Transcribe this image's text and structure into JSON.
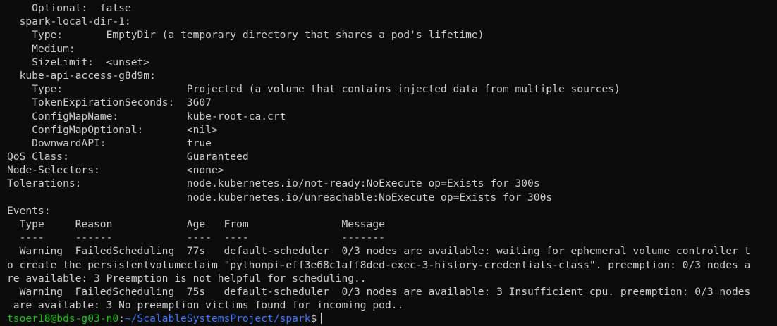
{
  "terminal": {
    "lines": [
      "    Optional:  false",
      "  spark-local-dir-1:",
      "    Type:       EmptyDir (a temporary directory that shares a pod's lifetime)",
      "    Medium:",
      "    SizeLimit:  <unset>",
      "  kube-api-access-g8d9m:",
      "    Type:                    Projected (a volume that contains injected data from multiple sources)",
      "    TokenExpirationSeconds:  3607",
      "    ConfigMapName:           kube-root-ca.crt",
      "    ConfigMapOptional:       <nil>",
      "    DownwardAPI:             true",
      "QoS Class:                   Guaranteed",
      "Node-Selectors:              <none>",
      "Tolerations:                 node.kubernetes.io/not-ready:NoExecute op=Exists for 300s",
      "                             node.kubernetes.io/unreachable:NoExecute op=Exists for 300s",
      "Events:",
      "  Type     Reason            Age   From               Message",
      "  ----     ------            ----  ----               -------",
      "  Warning  FailedScheduling  77s   default-scheduler  0/3 nodes are available: waiting for ephemeral volume controller t",
      "o create the persistentvolumeclaim \"pythonpi-eff3e68c1aff8ded-exec-3-history-credentials-class\". preemption: 0/3 nodes a",
      "re available: 3 Preemption is not helpful for scheduling..",
      "  Warning  FailedScheduling  75s   default-scheduler  0/3 nodes are available: 3 Insufficient cpu. preemption: 0/3 nodes",
      " are available: 3 No preemption victims found for incoming pod.."
    ],
    "prompt": {
      "user_host": "tsoer18@bds-g03-n0",
      "colon": ":",
      "path": "~/ScalableSystemsProject/spark",
      "symbol": "$"
    }
  },
  "colors": {
    "background": "#0c0c0c",
    "foreground": "#cccccc",
    "prompt_user": "#16c60c",
    "prompt_path": "#3b78ff"
  }
}
